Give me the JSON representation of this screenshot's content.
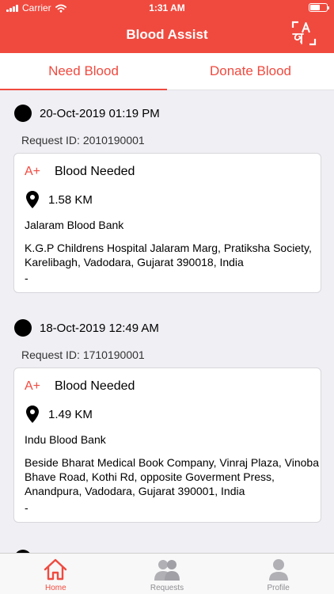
{
  "status": {
    "carrier": "Carrier",
    "time": "1:31 AM"
  },
  "header": {
    "title": "Blood Assist",
    "lang_icon": "translate-icon"
  },
  "tabs": [
    {
      "label": "Need Blood",
      "active": true
    },
    {
      "label": "Donate Blood",
      "active": false
    }
  ],
  "requests": [
    {
      "datetime": "20-Oct-2019 01:19 PM",
      "request_id": "Request ID: 2010190001",
      "blood_group": "A+",
      "status": "Blood Needed",
      "distance": "1.58 KM",
      "bank": "Jalaram Blood Bank",
      "address": "K.G.P Childrens Hospital Jalaram Marg, Pratiksha Society, Karelibagh, Vadodara, Gujarat 390018, India",
      "note": "-"
    },
    {
      "datetime": "18-Oct-2019 12:49 AM",
      "request_id": "Request ID: 1710190001",
      "blood_group": "A+",
      "status": "Blood Needed",
      "distance": "1.49 KM",
      "bank": "Indu Blood Bank",
      "address": "Beside Bharat Medical Book Company, Vinraj Plaza, Vinoba Bhave Road, Kothi Rd, opposite Goverment Press, Anandpura, Vadodara, Gujarat 390001, India",
      "note": "-"
    }
  ],
  "tabbar": [
    {
      "label": "Home",
      "icon": "home-icon",
      "active": true
    },
    {
      "label": "Requests",
      "icon": "users-icon",
      "active": false
    },
    {
      "label": "Profile",
      "icon": "profile-icon",
      "active": false
    }
  ],
  "colors": {
    "accent": "#f04a3f",
    "background": "#efeff4"
  }
}
